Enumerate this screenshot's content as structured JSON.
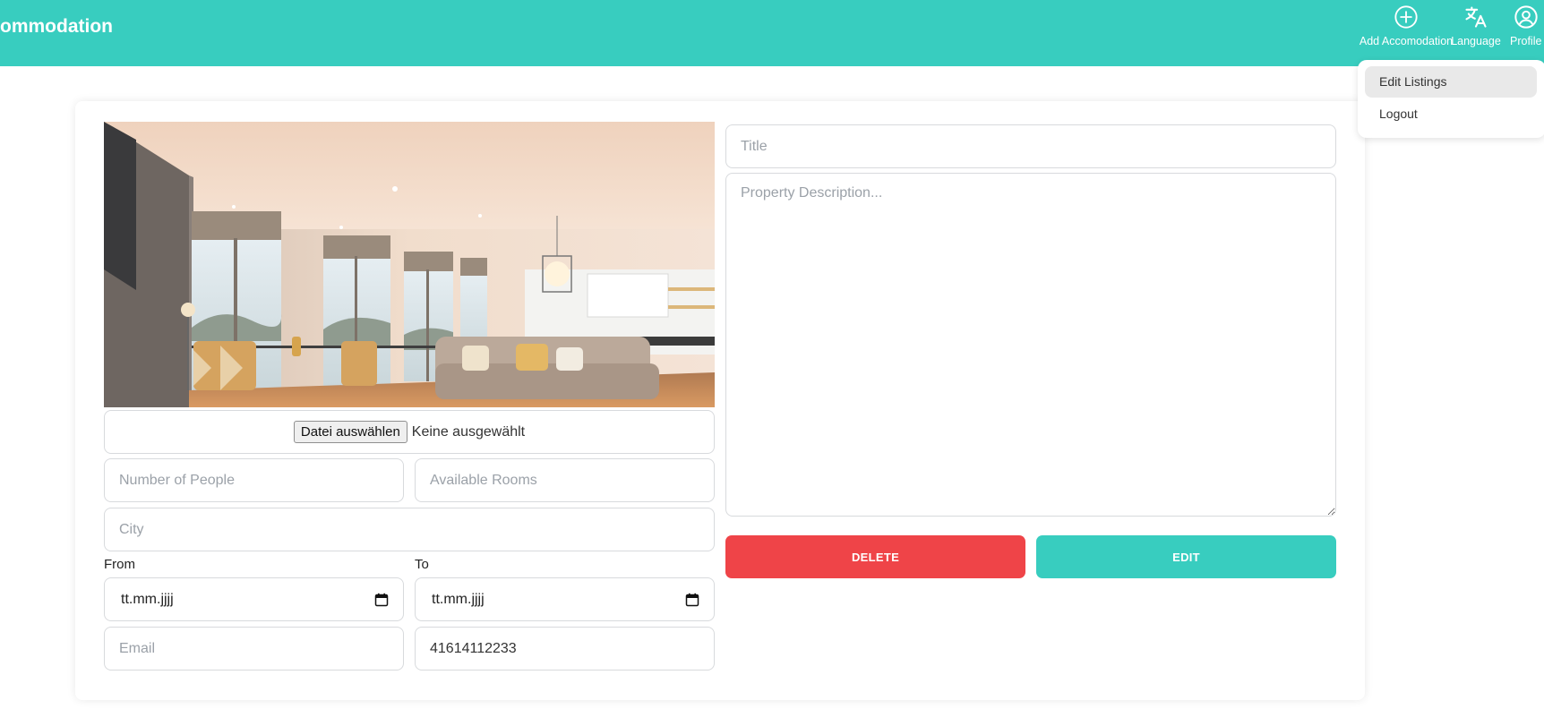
{
  "header": {
    "brand": "ommodation",
    "nav": {
      "add_label": "Add Accomodation",
      "language_label": "Language",
      "profile_label": "Profile"
    },
    "colors": {
      "primary": "#38cdbf"
    }
  },
  "dropdown": {
    "items": [
      {
        "label": "Edit Listings",
        "active": true
      },
      {
        "label": "Logout",
        "active": false
      }
    ]
  },
  "form": {
    "file": {
      "button_label": "Datei auswählen",
      "status": "Keine ausgewählt"
    },
    "people": {
      "placeholder": "Number of People",
      "value": ""
    },
    "rooms": {
      "placeholder": "Available Rooms",
      "value": ""
    },
    "city": {
      "placeholder": "City",
      "value": ""
    },
    "from": {
      "label": "From",
      "value": "tt.mm.jjjj"
    },
    "to": {
      "label": "To",
      "value": "tt.mm.jjjj"
    },
    "email": {
      "placeholder": "Email",
      "value": ""
    },
    "phone": {
      "placeholder": "",
      "value": "41614112233"
    },
    "title": {
      "placeholder": "Title",
      "value": ""
    },
    "description": {
      "placeholder": "Property Description...",
      "value": ""
    },
    "actions": {
      "delete_label": "DELETE",
      "edit_label": "EDIT",
      "delete_color": "#ef4448",
      "edit_color": "#38cdbf"
    }
  }
}
